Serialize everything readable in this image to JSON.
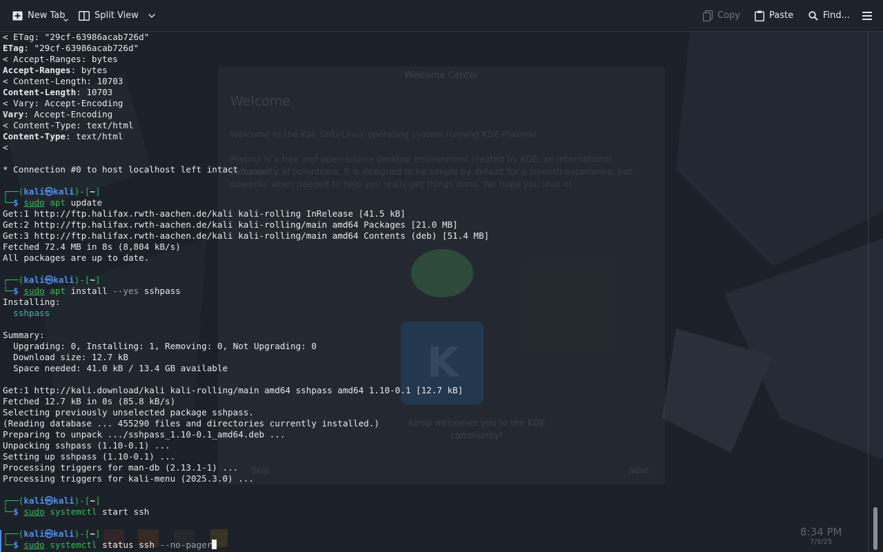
{
  "toolbar": {
    "new_tab": "New Tab",
    "split_view": "Split View",
    "copy": "Copy",
    "paste": "Paste",
    "find": "Find..."
  },
  "welcome": {
    "title": "Welcome Center",
    "heading": "Welcome",
    "line1": "Welcome to the Kali GNU/Linux operating system running KDE Plasma!",
    "para1": "Plasma is a free and open-source desktop environment created by KDE, an international software",
    "para2": "community of volunteers. It is designed to be simple by default for a smooth experience, but",
    "para3": "powerful when needed to help you really get things done. We hope you love it!",
    "caption1": "Konqi welcomes you to the KDE",
    "caption2": "community!",
    "skip": "Skip",
    "next": "Next"
  },
  "taskbar": {
    "time": "8:34 PM",
    "date": "7/9/25"
  },
  "terminal": {
    "output_top": [
      "< ETag: \"29cf-63986acab726d\"",
      ": \"29cf-63986acab726d\"",
      "< Accept-Ranges: bytes",
      ": bytes",
      "< Content-Length: 10703",
      ": 10703",
      "< Vary: Accept-Encoding",
      ": Accept-Encoding",
      "< Content-Type: text/html",
      ": text/html",
      "<",
      "* Connection #0 to host localhost left intact"
    ],
    "header_keys": [
      "ETag",
      "Accept-Ranges",
      "Content-Length",
      "Vary",
      "Content-Type"
    ],
    "prompt": {
      "open": "┌──(",
      "user": "kali",
      "at": "㉿",
      "host": "kali",
      "close": ")-[",
      "dir": "~",
      "end": "]",
      "corner": "└─",
      "dollar": "$"
    },
    "sudo": "sudo",
    "commands": [
      {
        "prog": "apt",
        "args": " update"
      },
      {
        "prog": "apt",
        "args": " install ",
        "flag": "--yes",
        "rest": " sshpass"
      },
      {
        "prog": "systemctl",
        "args": " start ssh"
      },
      {
        "prog": "systemctl",
        "args": " status ssh ",
        "flag": "--no-pager"
      }
    ],
    "apt_update": [
      "Get:1 http://ftp.halifax.rwth-aachen.de/kali kali-rolling InRelease [41.5 kB]",
      "Get:2 http://ftp.halifax.rwth-aachen.de/kali kali-rolling/main amd64 Packages [21.0 MB]",
      "Get:3 http://ftp.halifax.rwth-aachen.de/kali kali-rolling/main amd64 Contents (deb) [51.4 MB]",
      "Fetched 72.4 MB in 8s (8,804 kB/s)",
      "All packages are up to date."
    ],
    "apt_install": {
      "installing": "Installing:",
      "package": "  sshpass",
      "summary": "Summary:",
      "summary_lines": [
        "  Upgrading: 0, Installing: 1, Removing: 0, Not Upgrading: 0",
        "  Download size: 12.7 kB",
        "  Space needed: 41.0 kB / 13.4 GB available"
      ],
      "log": [
        "Get:1 http://kali.download/kali kali-rolling/main amd64 sshpass amd64 1.10-0.1 [12.7 kB]",
        "Fetched 12.7 kB in 0s (85.8 kB/s)",
        "Selecting previously unselected package sshpass.",
        "(Reading database ... 455290 files and directories currently installed.)",
        "Preparing to unpack .../sshpass_1.10-0.1_amd64.deb ...",
        "Unpacking sshpass (1.10-0.1) ...",
        "Setting up sshpass (1.10-0.1) ...",
        "Processing triggers for man-db (2.13.1-1) ...",
        "Processing triggers for kali-menu (2025.3.0) ..."
      ]
    }
  }
}
